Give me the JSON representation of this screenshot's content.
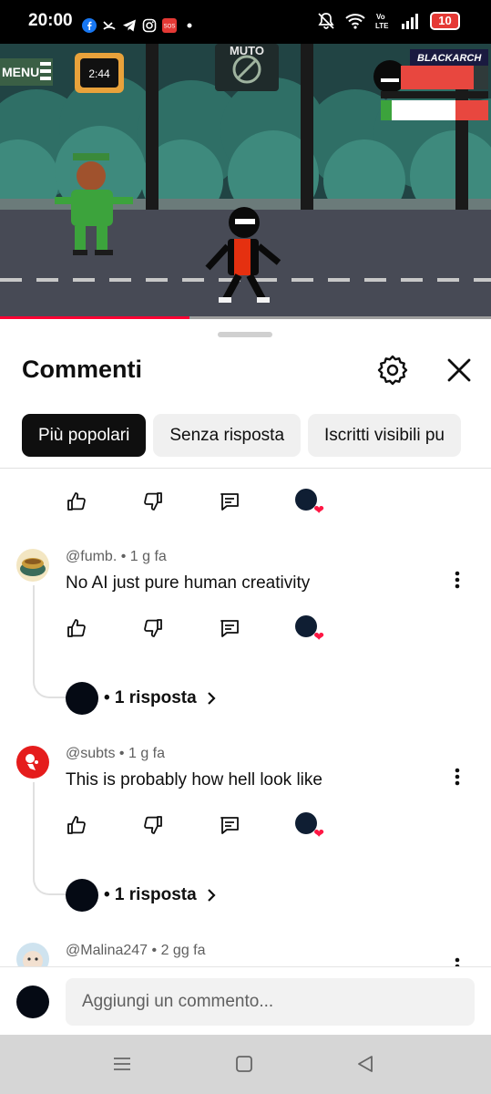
{
  "status_bar": {
    "time": "20:00",
    "notification_icons": [
      "facebook-icon",
      "missed-call-icon",
      "telegram-icon",
      "instagram-icon",
      "sos-icon",
      "dot-icon"
    ],
    "system_icons": [
      "mute-icon",
      "wifi-icon",
      "volte-icon",
      "signal-icon"
    ],
    "volte_label": "Vo\nLTE",
    "battery": "10"
  },
  "video": {
    "menu_label": "MENU",
    "timer": "2:44",
    "muto_label": "MUTO",
    "player_name": "BLACKARCH",
    "progress_percent": 38.5
  },
  "sheet": {
    "title": "Commenti",
    "chips": [
      {
        "label": "Più popolari",
        "active": true
      },
      {
        "label": "Senza risposta",
        "active": false
      },
      {
        "label": "Iscritti visibili pu",
        "active": false
      }
    ]
  },
  "comments": [
    {
      "author": "@fumb.",
      "time": "1 g fa",
      "text": "No AI just pure human creativity",
      "replies_label": "• 1 risposta"
    },
    {
      "author": "@subts",
      "time": "1 g fa",
      "text": "This is probably how hell look like",
      "replies_label": "• 1 risposta"
    },
    {
      "author": "@Malina247",
      "time": "2 gg fa",
      "text": ""
    }
  ],
  "meta_separator": " • ",
  "add_comment": {
    "placeholder": "Aggiungi un commento..."
  },
  "colors": {
    "accent_red": "#ff0033",
    "chip_active_bg": "#0f0f0f",
    "chip_bg": "#f0f0f0"
  }
}
